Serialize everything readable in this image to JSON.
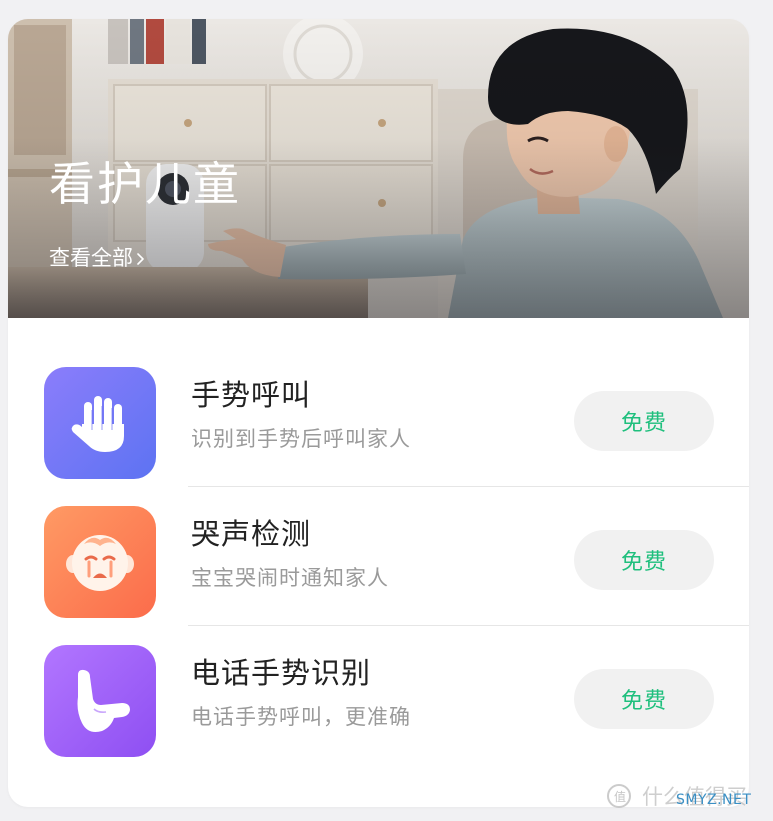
{
  "banner": {
    "title": "看护儿童",
    "link_label": "查看全部"
  },
  "features": [
    {
      "icon": "hand-raise-icon",
      "title": "手势呼叫",
      "description": "识别到手势后呼叫家人",
      "price_label": "免费",
      "tile_colors": [
        "#8b7dfb",
        "#5d73f2"
      ]
    },
    {
      "icon": "crying-baby-icon",
      "title": "哭声检测",
      "description": "宝宝哭闹时通知家人",
      "price_label": "免费",
      "tile_colors": [
        "#ff9a64",
        "#fb6c4b"
      ]
    },
    {
      "icon": "phone-gesture-icon",
      "title": "电话手势识别",
      "description": "电话手势呼叫，更准确",
      "price_label": "免费",
      "tile_colors": [
        "#b276ff",
        "#8e4ff2"
      ]
    }
  ],
  "colors": {
    "accent_green": "#1fbf7d",
    "title_text": "#222222",
    "secondary_text": "#9a9a9a"
  },
  "watermark": {
    "text": "什么值得买",
    "site": "SMYZ.NET"
  }
}
